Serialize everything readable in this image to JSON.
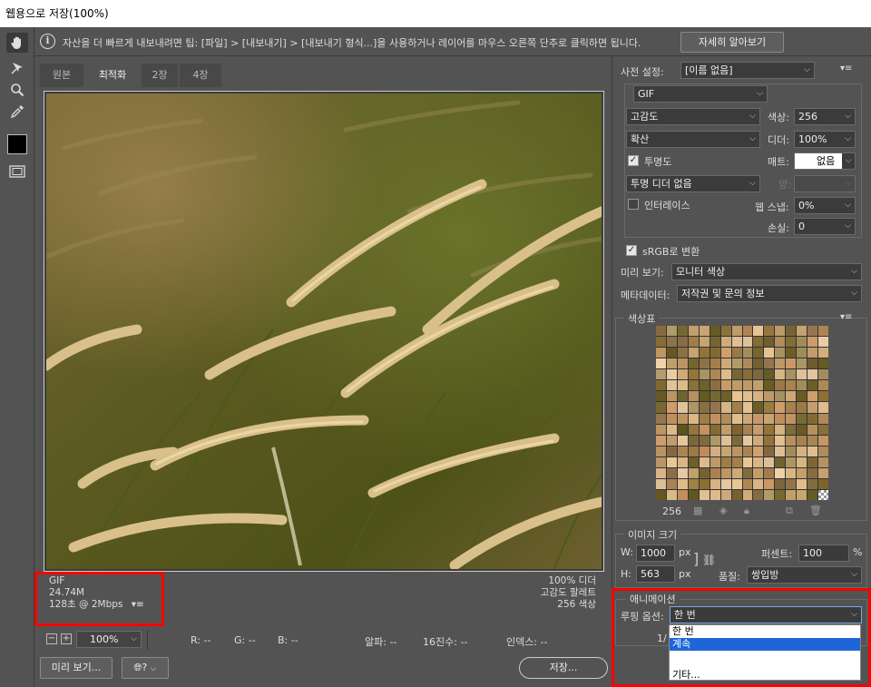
{
  "window": {
    "title": "웹용으로 저장(100%)"
  },
  "tip": {
    "text": "자산을 더 빠르게 내보내려면 팁: [파일] > [내보내기] > [내보내기 형식...]을 사용하거나 레이어를 마우스 오른쪽 단추로 클릭하면 됩니다.",
    "learn_more": "자세히 알아보기"
  },
  "tools": [
    {
      "name": "hand-icon"
    },
    {
      "name": "slice-select-icon"
    },
    {
      "name": "zoom-icon"
    },
    {
      "name": "eyedropper-icon"
    },
    {
      "name": "eyedropper-color-swatch",
      "color": "#000000"
    },
    {
      "name": "toggle-slices-icon"
    }
  ],
  "tabs": [
    "원본",
    "최적화",
    "2장",
    "4장"
  ],
  "preview": {
    "format": "GIF",
    "size": "24.74M",
    "time": "128초 @ 2Mbps",
    "dither": "100% 디더",
    "palette": "고감도 팔레트",
    "colors": "256 색상"
  },
  "status": {
    "zoom": "100%",
    "r": "R: --",
    "g": "G: --",
    "b": "B: --",
    "alpha": "알파: --",
    "hex": "16진수: --",
    "index": "인덱스: --"
  },
  "bottom": {
    "preview_btn": "미리 보기...",
    "save_btn": "저장..."
  },
  "settings": {
    "preset_label": "사전 설정:",
    "preset_value": "[이름 없음]",
    "format": "GIF",
    "reduction": "고감도",
    "colors_label": "색상:",
    "colors_value": "256",
    "dither_algo": "확산",
    "dither_label": "디더:",
    "dither_value": "100%",
    "transparency_label": "투명도",
    "matte_label": "매트:",
    "matte_value": "없음",
    "trans_dither": "투명 디더 없음",
    "amount_label": "양:",
    "interlace_label": "인터레이스",
    "websnap_label": "웹 스냅:",
    "websnap_value": "0%",
    "lossy_label": "손실:",
    "lossy_value": "0",
    "srgb_label": "sRGB로 변환",
    "preview_label": "미리 보기:",
    "preview_value": "모니터 색상",
    "metadata_label": "메타데이터:",
    "metadata_value": "저작권 및 문의 정보"
  },
  "color_table": {
    "title": "색상표",
    "count": "256"
  },
  "image_size": {
    "title": "이미지 크기",
    "w_label": "W:",
    "w_value": "1000",
    "w_unit": "px",
    "h_label": "H:",
    "h_value": "563",
    "h_unit": "px",
    "percent_label": "퍼센트:",
    "percent_value": "100",
    "percent_unit": "%",
    "quality_label": "품질:",
    "quality_value": "쌍입방"
  },
  "animation": {
    "title": "애니메이션",
    "loop_label": "루핑 옵션:",
    "loop_value": "한 번",
    "frame": "1/",
    "options": [
      "한 번",
      "계속",
      "",
      "기타..."
    ]
  }
}
